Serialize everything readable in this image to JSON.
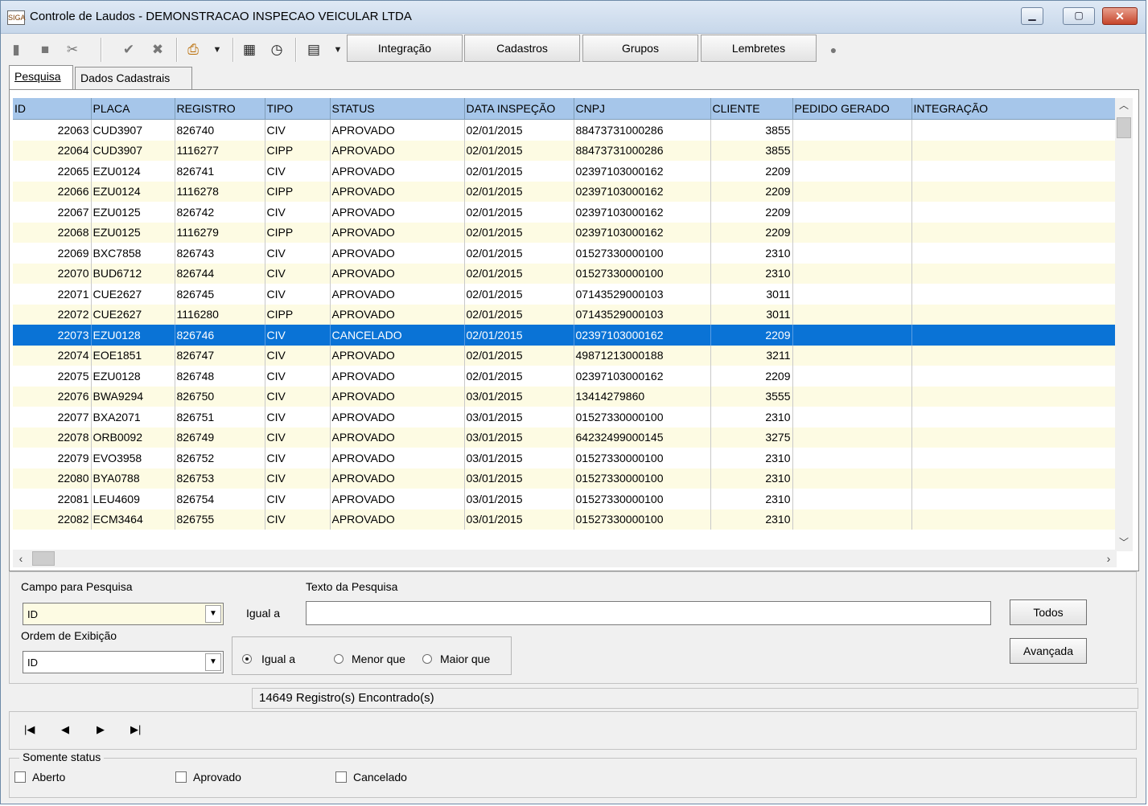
{
  "window": {
    "title": "Controle de Laudos - DEMONSTRACAO INSPECAO VEICULAR LTDA",
    "app_icon_text": "SIGA"
  },
  "toolbar": {
    "buttons": [
      "Integração",
      "Cadastros",
      "Grupos",
      "Lembretes"
    ]
  },
  "tabs": [
    {
      "label": "Pesquisa",
      "active": true
    },
    {
      "label": "Dados Cadastrais",
      "active": false
    }
  ],
  "grid": {
    "columns": [
      "ID",
      "PLACA",
      "REGISTRO",
      "TIPO",
      "STATUS",
      "DATA INSPEÇÃO",
      "CNPJ",
      "CLIENTE",
      "PEDIDO GERADO",
      "INTEGRAÇÃO"
    ],
    "selected_index": 10,
    "rows": [
      [
        "22063",
        "CUD3907",
        "826740",
        "CIV",
        "APROVADO",
        "02/01/2015",
        "88473731000286",
        "3855",
        "",
        ""
      ],
      [
        "22064",
        "CUD3907",
        "1116277",
        "CIPP",
        "APROVADO",
        "02/01/2015",
        "88473731000286",
        "3855",
        "",
        ""
      ],
      [
        "22065",
        "EZU0124",
        "826741",
        "CIV",
        "APROVADO",
        "02/01/2015",
        "02397103000162",
        "2209",
        "",
        ""
      ],
      [
        "22066",
        "EZU0124",
        "1116278",
        "CIPP",
        "APROVADO",
        "02/01/2015",
        "02397103000162",
        "2209",
        "",
        ""
      ],
      [
        "22067",
        "EZU0125",
        "826742",
        "CIV",
        "APROVADO",
        "02/01/2015",
        "02397103000162",
        "2209",
        "",
        ""
      ],
      [
        "22068",
        "EZU0125",
        "1116279",
        "CIPP",
        "APROVADO",
        "02/01/2015",
        "02397103000162",
        "2209",
        "",
        ""
      ],
      [
        "22069",
        "BXC7858",
        "826743",
        "CIV",
        "APROVADO",
        "02/01/2015",
        "01527330000100",
        "2310",
        "",
        ""
      ],
      [
        "22070",
        "BUD6712",
        "826744",
        "CIV",
        "APROVADO",
        "02/01/2015",
        "01527330000100",
        "2310",
        "",
        ""
      ],
      [
        "22071",
        "CUE2627",
        "826745",
        "CIV",
        "APROVADO",
        "02/01/2015",
        "07143529000103",
        "3011",
        "",
        ""
      ],
      [
        "22072",
        "CUE2627",
        "1116280",
        "CIPP",
        "APROVADO",
        "02/01/2015",
        "07143529000103",
        "3011",
        "",
        ""
      ],
      [
        "22073",
        "EZU0128",
        "826746",
        "CIV",
        "CANCELADO",
        "02/01/2015",
        "02397103000162",
        "2209",
        "",
        ""
      ],
      [
        "22074",
        "EOE1851",
        "826747",
        "CIV",
        "APROVADO",
        "02/01/2015",
        "49871213000188",
        "3211",
        "",
        ""
      ],
      [
        "22075",
        "EZU0128",
        "826748",
        "CIV",
        "APROVADO",
        "02/01/2015",
        "02397103000162",
        "2209",
        "",
        ""
      ],
      [
        "22076",
        "BWA9294",
        "826750",
        "CIV",
        "APROVADO",
        "03/01/2015",
        "13414279860",
        "3555",
        "",
        ""
      ],
      [
        "22077",
        "BXA2071",
        "826751",
        "CIV",
        "APROVADO",
        "03/01/2015",
        "01527330000100",
        "2310",
        "",
        ""
      ],
      [
        "22078",
        "ORB0092",
        "826749",
        "CIV",
        "APROVADO",
        "03/01/2015",
        "64232499000145",
        "3275",
        "",
        ""
      ],
      [
        "22079",
        "EVO3958",
        "826752",
        "CIV",
        "APROVADO",
        "03/01/2015",
        "01527330000100",
        "2310",
        "",
        ""
      ],
      [
        "22080",
        "BYA0788",
        "826753",
        "CIV",
        "APROVADO",
        "03/01/2015",
        "01527330000100",
        "2310",
        "",
        ""
      ],
      [
        "22081",
        "LEU4609",
        "826754",
        "CIV",
        "APROVADO",
        "03/01/2015",
        "01527330000100",
        "2310",
        "",
        ""
      ],
      [
        "22082",
        "ECM3464",
        "826755",
        "CIV",
        "APROVADO",
        "03/01/2015",
        "01527330000100",
        "2310",
        "",
        ""
      ]
    ]
  },
  "search": {
    "campo_label": "Campo para Pesquisa",
    "campo_value": "ID",
    "texto_label": "Texto da Pesquisa",
    "texto_value": "",
    "igual_label": "Igual a",
    "ordem_label": "Ordem de Exibição",
    "ordem_value": "ID",
    "radio_igual": "Igual a",
    "radio_menor": "Menor que",
    "radio_maior": "Maior que",
    "todos_button": "Todos",
    "avancada_button": "Avançada"
  },
  "status_text": "14649 Registro(s) Encontrado(s)",
  "filter": {
    "legend": "Somente status",
    "aberto": "Aberto",
    "aprovado": "Aprovado",
    "cancelado": "Cancelado"
  }
}
